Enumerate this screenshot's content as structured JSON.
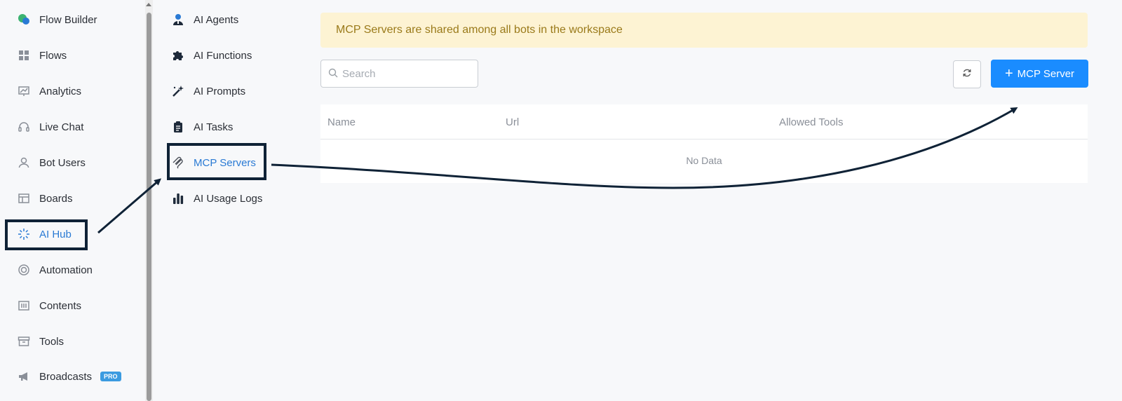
{
  "sidebar": {
    "items": [
      {
        "label": "Flow Builder",
        "icon": "chat-bubbles-icon"
      },
      {
        "label": "Flows",
        "icon": "grid-icon"
      },
      {
        "label": "Analytics",
        "icon": "chart-icon"
      },
      {
        "label": "Live Chat",
        "icon": "headset-icon"
      },
      {
        "label": "Bot Users",
        "icon": "user-icon"
      },
      {
        "label": "Boards",
        "icon": "board-icon"
      },
      {
        "label": "AI Hub",
        "icon": "sparkle-icon"
      },
      {
        "label": "Automation",
        "icon": "lifebuoy-icon"
      },
      {
        "label": "Contents",
        "icon": "contents-icon"
      },
      {
        "label": "Tools",
        "icon": "archive-icon"
      },
      {
        "label": "Broadcasts",
        "icon": "megaphone-icon",
        "badge": "PRO"
      }
    ]
  },
  "subnav": {
    "items": [
      {
        "label": "AI Agents",
        "icon": "agent-icon"
      },
      {
        "label": "AI Functions",
        "icon": "puzzle-icon"
      },
      {
        "label": "AI Prompts",
        "icon": "magic-wand-icon"
      },
      {
        "label": "AI Tasks",
        "icon": "clipboard-icon"
      },
      {
        "label": "MCP Servers",
        "icon": "mcp-icon"
      },
      {
        "label": "AI Usage Logs",
        "icon": "bar-chart-icon"
      }
    ]
  },
  "main": {
    "banner": "MCP Servers are shared among all bots in the workspace",
    "search_placeholder": "Search",
    "add_button_label": "MCP Server",
    "table": {
      "columns": [
        "Name",
        "Url",
        "Allowed Tools"
      ],
      "empty_text": "No Data"
    }
  },
  "colors": {
    "accent": "#1a8cff",
    "active_nav": "#2a7ad4",
    "banner_bg": "#fdf3d3",
    "banner_text": "#9a7a1a",
    "annotation": "#0f2236"
  }
}
